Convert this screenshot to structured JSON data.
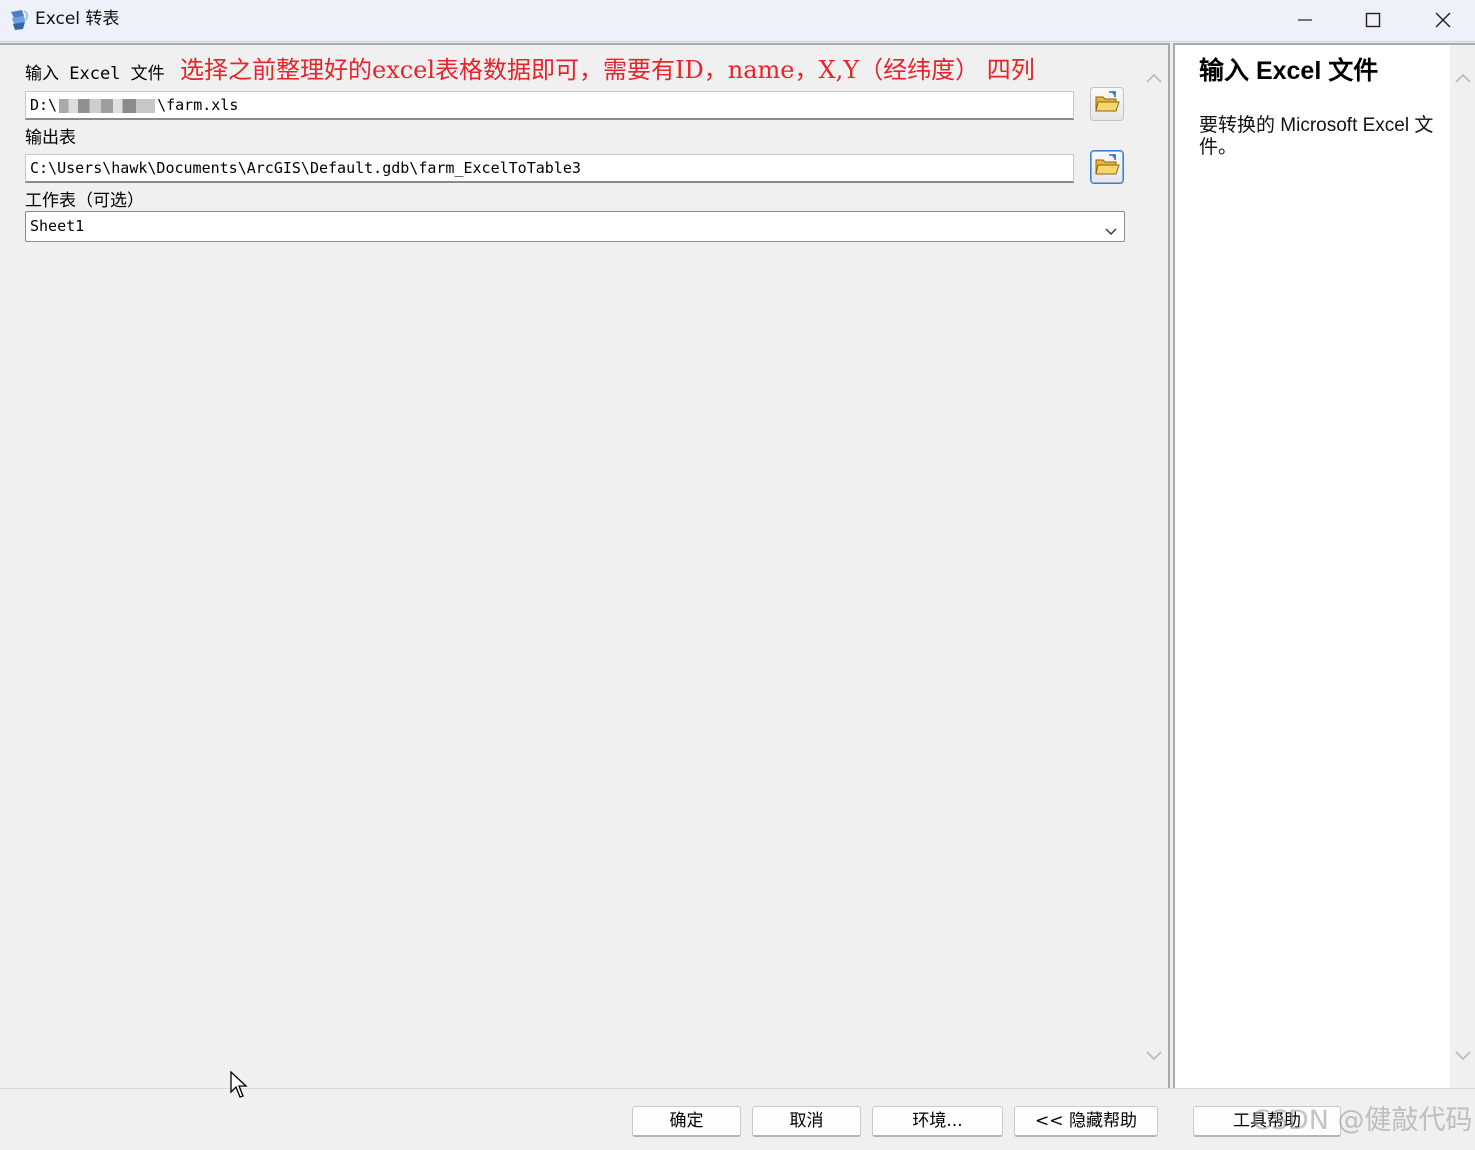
{
  "window": {
    "title": "Excel 转表",
    "icon": "arcgis-tool-icon"
  },
  "form": {
    "input_label": "输入 Excel 文件",
    "annotation": "选择之前整理好的excel表格数据即可，需要有ID，name，X,Y（经纬度） 四列",
    "input_value_prefix": "D:\\",
    "input_value_suffix": "\\farm.xls",
    "output_label": "输出表",
    "output_value": "C:\\Users\\hawk\\Documents\\ArcGIS\\Default.gdb\\farm_ExcelToTable3",
    "sheet_label": "工作表（可选）",
    "sheet_value": "Sheet1"
  },
  "help": {
    "title": "输入 Excel 文件",
    "description": "要转换的 Microsoft Excel 文件。"
  },
  "buttons": {
    "ok": "确定",
    "cancel": "取消",
    "environments": "环境...",
    "hide_help": "<< 隐藏帮助",
    "tool_help": "工具帮助"
  },
  "watermark": "CSDN @健敲代码"
}
